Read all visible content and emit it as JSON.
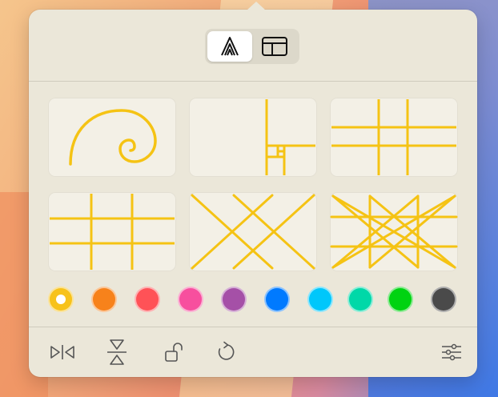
{
  "modes": [
    {
      "name": "composition-guides",
      "icon": "guides-icon",
      "active": true
    },
    {
      "name": "layout",
      "icon": "layout-icon",
      "active": false
    }
  ],
  "guides": [
    {
      "name": "golden-spiral",
      "icon": "golden-spiral-icon"
    },
    {
      "name": "golden-rectangle",
      "icon": "golden-rectangle-icon"
    },
    {
      "name": "phi-grid",
      "icon": "phi-grid-icon"
    },
    {
      "name": "rule-of-thirds",
      "icon": "rule-of-thirds-icon"
    },
    {
      "name": "diagonal-grid",
      "icon": "diagonal-grid-icon"
    },
    {
      "name": "dynamic-symmetry",
      "icon": "dynamic-symmetry-icon"
    }
  ],
  "guide_color": "#f5c314",
  "colors": [
    {
      "name": "yellow",
      "hex": "#f7c21b",
      "selected": true
    },
    {
      "name": "orange",
      "hex": "#f7821b",
      "selected": false
    },
    {
      "name": "red",
      "hex": "#ff5257",
      "selected": false
    },
    {
      "name": "pink",
      "hex": "#f74f9e",
      "selected": false
    },
    {
      "name": "purple",
      "hex": "#a550a7",
      "selected": false
    },
    {
      "name": "blue",
      "hex": "#007aff",
      "selected": false
    },
    {
      "name": "cyan",
      "hex": "#00c7fb",
      "selected": false
    },
    {
      "name": "teal",
      "hex": "#00d8a8",
      "selected": false
    },
    {
      "name": "green",
      "hex": "#00d311",
      "selected": false
    },
    {
      "name": "dark-gray",
      "hex": "#4a4a4a",
      "selected": false
    }
  ],
  "toolbar": [
    {
      "name": "flip-horizontal",
      "icon": "flip-horizontal-icon"
    },
    {
      "name": "flip-vertical",
      "icon": "flip-vertical-icon"
    },
    {
      "name": "lock",
      "icon": "unlock-icon"
    },
    {
      "name": "rotate",
      "icon": "rotate-icon"
    },
    {
      "name": "settings",
      "icon": "sliders-icon"
    }
  ]
}
